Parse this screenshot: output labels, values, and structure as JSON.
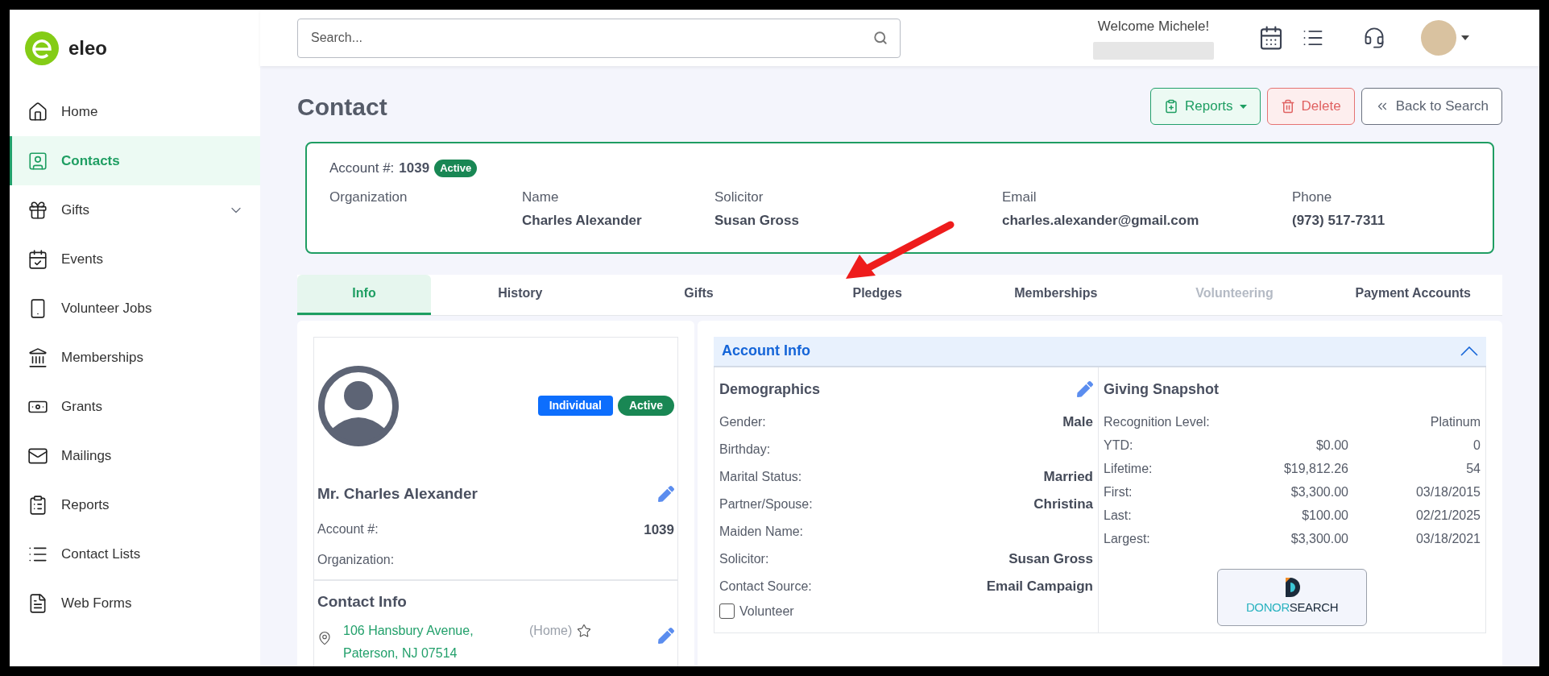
{
  "brand": {
    "name": "eleo"
  },
  "sidebar": {
    "items": [
      {
        "label": "Home",
        "selected": false,
        "has_submenu": false
      },
      {
        "label": "Contacts",
        "selected": true,
        "has_submenu": false
      },
      {
        "label": "Gifts",
        "selected": false,
        "has_submenu": true
      },
      {
        "label": "Events",
        "selected": false,
        "has_submenu": false
      },
      {
        "label": "Volunteer Jobs",
        "selected": false,
        "has_submenu": false
      },
      {
        "label": "Memberships",
        "selected": false,
        "has_submenu": false
      },
      {
        "label": "Grants",
        "selected": false,
        "has_submenu": false
      },
      {
        "label": "Mailings",
        "selected": false,
        "has_submenu": false
      },
      {
        "label": "Reports",
        "selected": false,
        "has_submenu": false
      },
      {
        "label": "Contact Lists",
        "selected": false,
        "has_submenu": false
      },
      {
        "label": "Web Forms",
        "selected": false,
        "has_submenu": false
      }
    ]
  },
  "header": {
    "search": {
      "placeholder": "Search..."
    },
    "welcome": "Welcome Michele!"
  },
  "page": {
    "title": "Contact",
    "buttons": [
      {
        "label": "Reports",
        "kind": "reports"
      },
      {
        "label": "Delete",
        "kind": "delete"
      },
      {
        "label": "Back to Search",
        "kind": "back"
      }
    ]
  },
  "summary": {
    "account_label": "Account #:",
    "account_number": "1039",
    "status": "Active",
    "fields": [
      {
        "label": "Organization"
      },
      {
        "label": "Name",
        "value": "Charles Alexander"
      },
      {
        "label": "Solicitor",
        "value": "Susan Gross"
      },
      {
        "label": "Email",
        "value": "charles.alexander@gmail.com"
      },
      {
        "label": "Phone",
        "value": "(973) 517-7311"
      }
    ]
  },
  "tabs": [
    {
      "label": "Info",
      "selected": true,
      "disabled": false
    },
    {
      "label": "History",
      "selected": false,
      "disabled": false
    },
    {
      "label": "Gifts",
      "selected": false,
      "disabled": false
    },
    {
      "label": "Pledges",
      "selected": false,
      "disabled": false
    },
    {
      "label": "Memberships",
      "selected": false,
      "disabled": false
    },
    {
      "label": "Volunteering",
      "selected": false,
      "disabled": true
    },
    {
      "label": "Payment Accounts",
      "selected": false,
      "disabled": false
    }
  ],
  "profile": {
    "badges": [
      {
        "label": "Individual",
        "color": "#0d6efd"
      },
      {
        "label": "Active",
        "color": "#198754"
      }
    ],
    "name": "Mr. Charles Alexander",
    "rows": [
      {
        "label": "Account #:",
        "value": "1039"
      },
      {
        "label": "Organization:"
      }
    ],
    "contact_info": {
      "title": "Contact Info",
      "address_lines": [
        "106 Hansbury Avenue,",
        "Paterson, NJ 07514"
      ],
      "address_type": "(Home)",
      "primary": false
    }
  },
  "account_info": {
    "title": "Account Info",
    "expanded": true,
    "demographics": {
      "title": "Demographics",
      "rows": [
        {
          "label": "Gender:",
          "value": "Male"
        },
        {
          "label": "Birthday:"
        },
        {
          "label": "Marital Status:",
          "value": "Married"
        },
        {
          "label": "Partner/Spouse:",
          "value": "Christina"
        },
        {
          "label": "Maiden Name:"
        },
        {
          "label": "Solicitor:",
          "value": "Susan Gross"
        },
        {
          "label": "Contact Source:",
          "value": "Email Campaign"
        }
      ],
      "volunteer": {
        "label": "Volunteer",
        "checked": false
      }
    },
    "giving": {
      "title": "Giving Snapshot",
      "recognition": {
        "label": "Recognition Level:",
        "value": "Platinum"
      },
      "rows": [
        {
          "label": "YTD:",
          "amount": "$0.00",
          "detail": "0"
        },
        {
          "label": "Lifetime:",
          "amount": "$19,812.26",
          "detail": "54"
        },
        {
          "label": "First:",
          "amount": "$3,300.00",
          "detail": "03/18/2015"
        },
        {
          "label": "Last:",
          "amount": "$100.00",
          "detail": "02/21/2025"
        },
        {
          "label": "Largest:",
          "amount": "$3,300.00",
          "detail": "03/18/2021"
        }
      ],
      "donorsearch": [
        "DONOR",
        "SEARCH"
      ]
    }
  }
}
